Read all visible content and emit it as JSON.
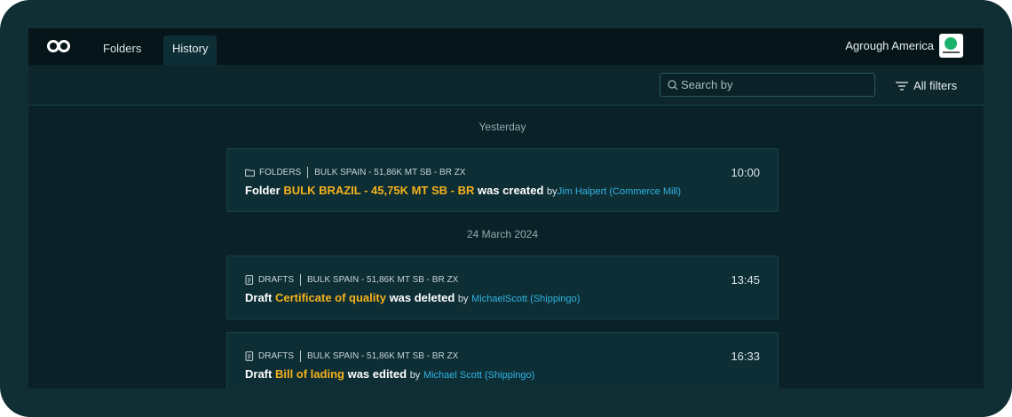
{
  "nav": {
    "tabs": [
      {
        "label": "Folders"
      },
      {
        "label": "History"
      }
    ],
    "org_name": "Agrough America"
  },
  "toolbar": {
    "search_placeholder": "Search by",
    "filters_label": "All filters"
  },
  "groups": [
    {
      "date": "Yesterday",
      "entries": [
        {
          "category": "FOLDERS",
          "category_icon": "folder-icon",
          "reference": "BULK SPAIN - 51,86K MT SB - BR ZX",
          "time": "10:00",
          "lead": "Folder",
          "subject": "BULK BRAZIL - 45,75K MT SB - BR",
          "action": "was created",
          "by": "by",
          "actor": "Jim Halpert (Commerce Mill)"
        }
      ]
    },
    {
      "date": "24 March 2024",
      "entries": [
        {
          "category": "DRAFTS",
          "category_icon": "draft-icon",
          "reference": "BULK SPAIN - 51,86K MT SB - BR ZX",
          "time": "13:45",
          "lead": "Draft",
          "subject": "Certificate of quality",
          "action": "was deleted",
          "by": "by",
          "actor": "MichaelScott (Shippingo)"
        },
        {
          "category": "DRAFTS",
          "category_icon": "draft-icon",
          "reference": "BULK SPAIN - 51,86K MT SB - BR ZX",
          "time": "16:33",
          "lead": "Draft",
          "subject": "Bill of lading",
          "action": "was edited",
          "by": "by",
          "actor": "Michael Scott (Shippingo)"
        }
      ]
    }
  ],
  "colors": {
    "frame": "#0f2f35",
    "topbar": "#061519",
    "card": "#0e2e35",
    "highlight": "#f5b21c",
    "link": "#2fb4e3"
  }
}
